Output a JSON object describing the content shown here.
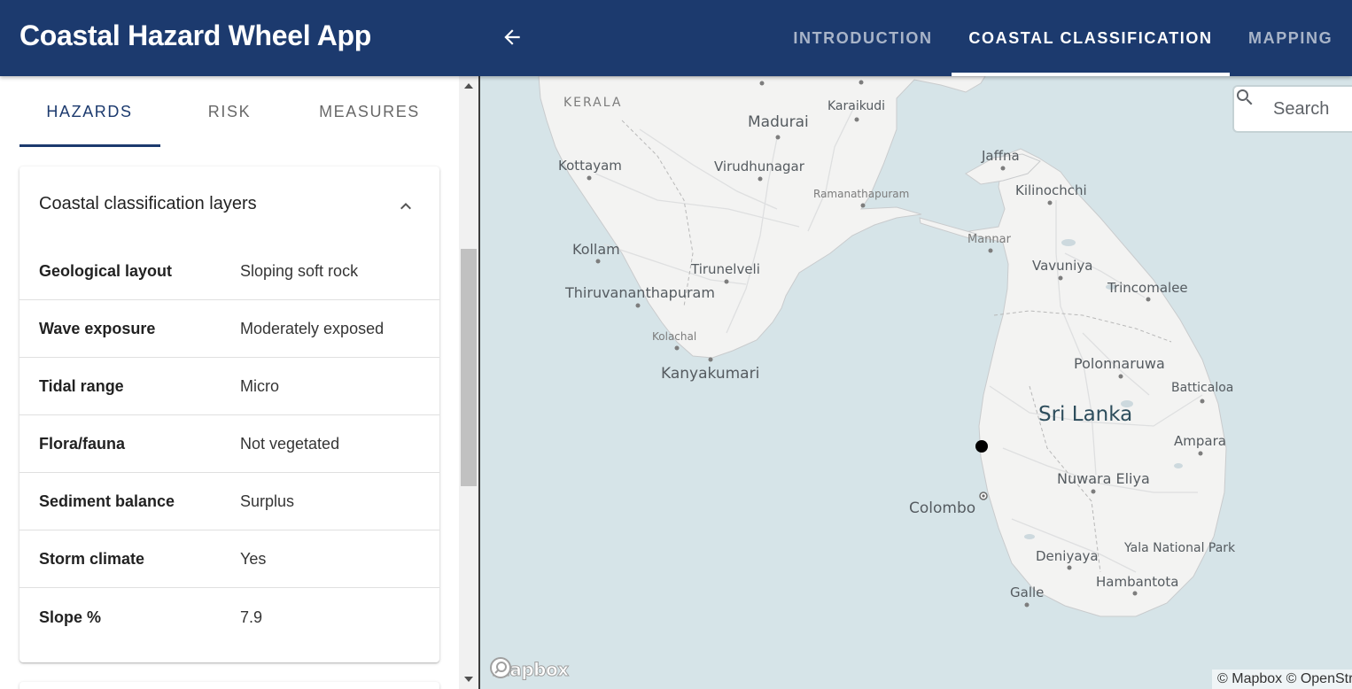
{
  "app": {
    "title": "Coastal Hazard Wheel App"
  },
  "nav": {
    "tabs": [
      {
        "label": "INTRODUCTION",
        "active": false
      },
      {
        "label": "COASTAL CLASSIFICATION",
        "active": true
      },
      {
        "label": "MAPPING",
        "active": false
      }
    ],
    "back_icon": "arrow-left-icon"
  },
  "sidebar": {
    "tabs": [
      {
        "label": "HAZARDS",
        "active": true
      },
      {
        "label": "RISK",
        "active": false
      },
      {
        "label": "MEASURES",
        "active": false
      }
    ],
    "card": {
      "title": "Coastal classification layers",
      "expanded": true,
      "rows": [
        {
          "label": "Geological layout",
          "value": "Sloping soft rock"
        },
        {
          "label": "Wave exposure",
          "value": "Moderately exposed"
        },
        {
          "label": "Tidal range",
          "value": "Micro"
        },
        {
          "label": "Flora/fauna",
          "value": "Not vegetated"
        },
        {
          "label": "Sediment balance",
          "value": "Surplus"
        },
        {
          "label": "Storm climate",
          "value": "Yes"
        },
        {
          "label": "Slope %",
          "value": "7.9"
        }
      ]
    }
  },
  "map": {
    "search": {
      "placeholder": "Search",
      "value": ""
    },
    "attribution": "© Mapbox © OpenStr",
    "logo": "mapbox",
    "labels": {
      "kerala": "KERALA",
      "madurai": "Madurai",
      "karaikudi": "Karaikudi",
      "kottayam": "Kottayam",
      "virudhunagar": "Virudhunagar",
      "ramanathapuram": "Ramanathapuram",
      "jaffna": "Jaffna",
      "kilinochchi": "Kilinochchi",
      "mannar": "Mannar",
      "kollam": "Kollam",
      "tirunelveli": "Tirunelveli",
      "vavuniya": "Vavuniya",
      "trincomalee": "Trincomalee",
      "thiruvananthapuram": "Thiruvananthapuram",
      "kolachal": "Kolachal",
      "kanyakumari": "Kanyakumari",
      "polonnaruwa": "Polonnaruwa",
      "batticaloa": "Batticaloa",
      "sri_lanka": "Sri Lanka",
      "ampara": "Ampara",
      "nuwara_eliya": "Nuwara Eliya",
      "colombo": "Colombo",
      "deniyaya": "Deniyaya",
      "yala": "Yala National Park",
      "hambantota": "Hambantota",
      "galle": "Galle"
    },
    "colors": {
      "water": "#d6e4e8",
      "land": "#f3f3f2",
      "marker": "#000000"
    }
  },
  "colors": {
    "primary": "#1c3a6e",
    "active_tab_text": "#ffffff",
    "inactive_tab_text": "#a9b5c9"
  }
}
